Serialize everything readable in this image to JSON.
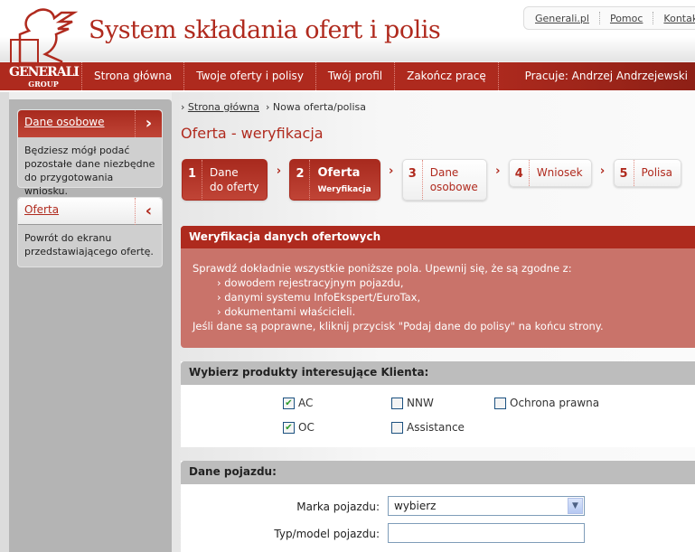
{
  "header": {
    "title": "System składania ofert i polis",
    "logo_text": "GENERALI",
    "logo_sub": "GROUP",
    "top_links": [
      "Generali.pl",
      "Pomoc",
      "Kontakt"
    ]
  },
  "nav": {
    "items": [
      "Strona główna",
      "Twoje oferty i polisy",
      "Twój profil",
      "Zakończ pracę"
    ],
    "user": "Pracuje: Andrzej Andrzejewski"
  },
  "sidebar": {
    "boxes": [
      {
        "title": "Dane osobowe",
        "icon": "chevron-right-icon",
        "text": "Będziesz mógł podać pozostałe dane niezbędne do przygotowania wniosku."
      },
      {
        "title": "Oferta",
        "icon": "chevron-left-icon",
        "text": "Powrót do ekranu przedstawiającego ofertę."
      }
    ]
  },
  "breadcrumb": {
    "home": "Strona główna",
    "current": "Nowa oferta/polisa"
  },
  "page_title": "Oferta - weryfikacja",
  "steps": [
    {
      "num": "1",
      "line1": "Dane",
      "line2": "do oferty"
    },
    {
      "num": "2",
      "line1": "Oferta",
      "line2": "Weryfikacja"
    },
    {
      "num": "3",
      "line1": "Dane",
      "line2": "osobowe"
    },
    {
      "num": "4",
      "line1": "Wniosek"
    },
    {
      "num": "5",
      "line1": "Polisa"
    }
  ],
  "verify": {
    "title": "Weryfikacja danych ofertowych",
    "intro": "Sprawdź dokładnie wszystkie poniższe pola. Upewnij się, że są zgodne z:",
    "items": [
      "› dowodem rejestracyjnym pojazdu,",
      "› danymi systemu InfoEkspert/EuroTax,",
      "› dokumentami właścicieli."
    ],
    "outro": "Jeśli dane są poprawne, kliknij przycisk \"Podaj dane do polisy\" na końcu strony."
  },
  "products": {
    "title": "Wybierz produkty interesujące Klienta:",
    "items": [
      {
        "label": "AC",
        "checked": true
      },
      {
        "label": "NNW",
        "checked": false
      },
      {
        "label": "Ochrona prawna",
        "checked": false
      },
      {
        "label": "OC",
        "checked": true
      },
      {
        "label": "Assistance",
        "checked": false
      }
    ]
  },
  "vehicle": {
    "title": "Dane pojazdu:",
    "make_label": "Marka pojazdu:",
    "make_value": "wybierz",
    "model_label": "Typ/model pojazdu:",
    "model_value": ""
  },
  "colors": {
    "brand_red": "#ae2a1e",
    "notice_bg": "#c9736a",
    "section_header": "#bdbdbd"
  }
}
